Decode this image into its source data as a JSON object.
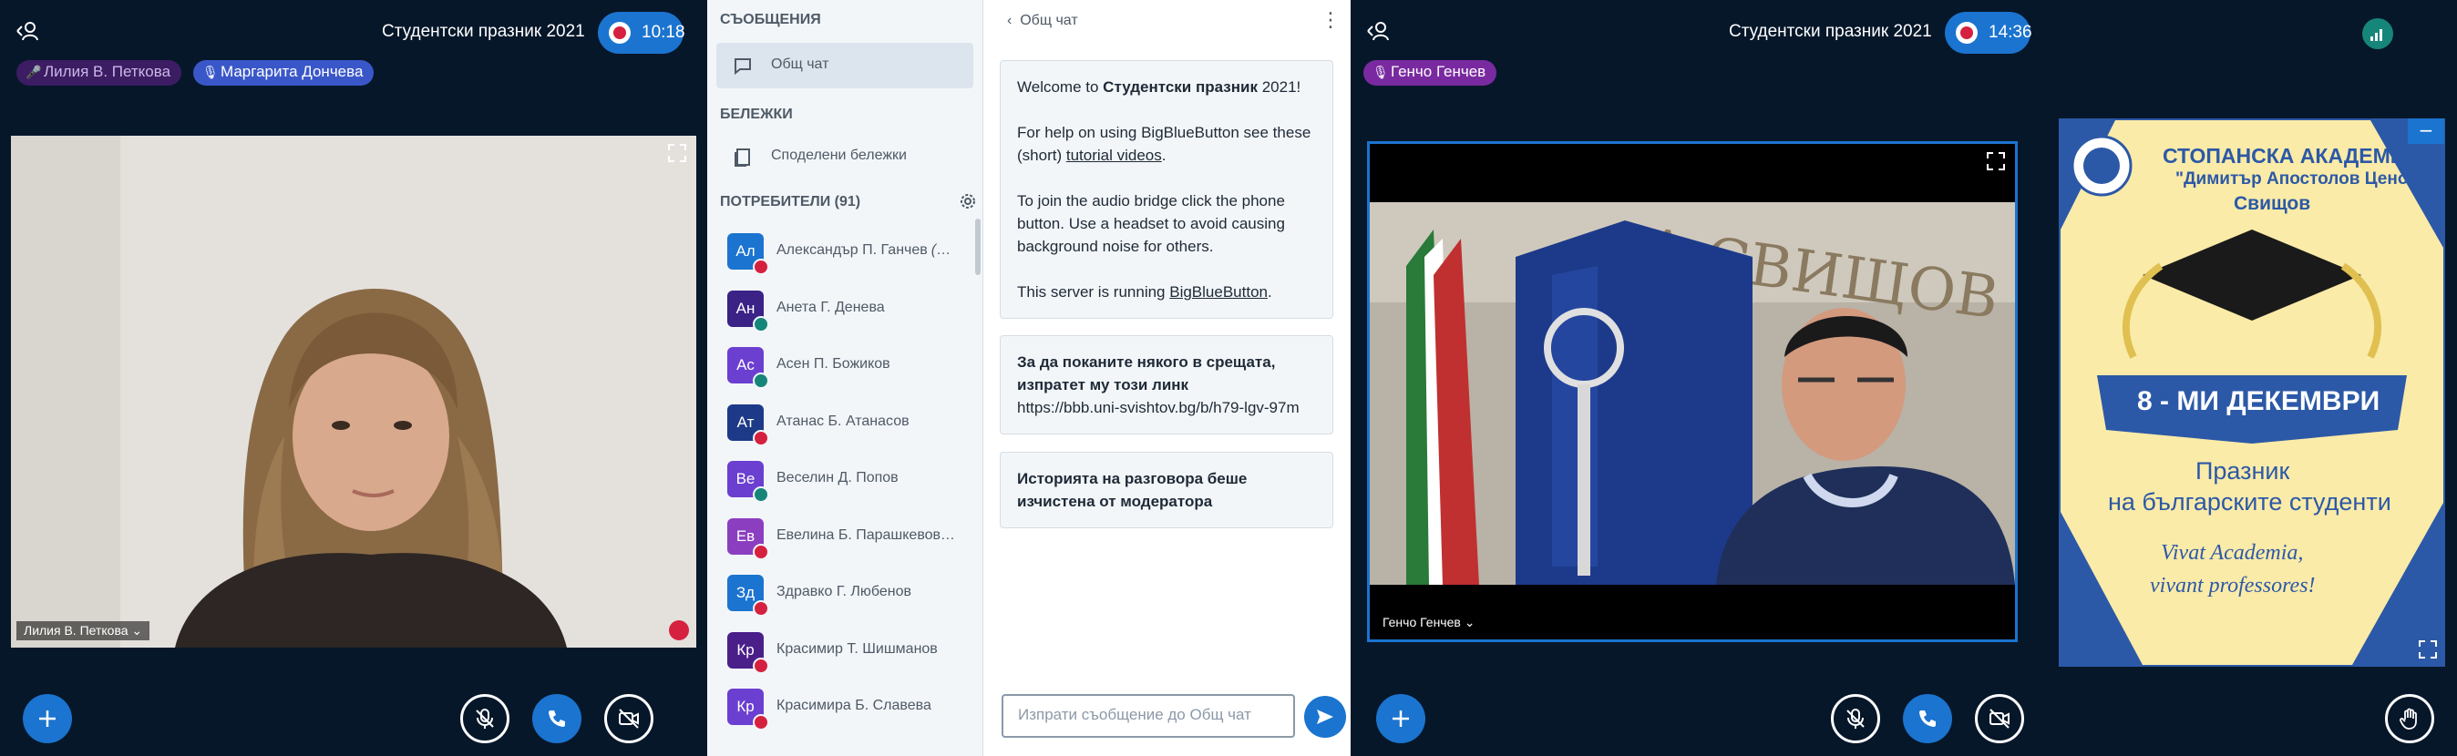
{
  "left_meeting": {
    "title": "Студентски празник 2021",
    "timer": "10:18",
    "talkers": [
      "Лилия В. Петкова",
      "Маргарита Дончева"
    ],
    "video_name": "Лилия В. Петкова"
  },
  "sidebar": {
    "messages_title": "СЪОБЩЕНИЯ",
    "public_chat": "Общ чат",
    "notes_title": "БЕЛЕЖКИ",
    "shared_notes": "Споделени бележки",
    "users_title": "ПОТРЕБИТЕЛИ (91)",
    "users": [
      {
        "initials": "Ал",
        "name": "Александър П. Ганчев",
        "suffix": "(Вие)",
        "color": "#1b74cf",
        "status": "muted"
      },
      {
        "initials": "Ан",
        "name": "Анета Г. Денева",
        "color": "#3a2287",
        "status": "listen"
      },
      {
        "initials": "Ас",
        "name": "Асен П. Божиков",
        "color": "#6b3fd0",
        "status": "listen"
      },
      {
        "initials": "Ат",
        "name": "Атанас Б. Атанасов",
        "color": "#1c3a87",
        "status": "muted"
      },
      {
        "initials": "Ве",
        "name": "Веселин Д. Попов",
        "color": "#6b3fd0",
        "status": "listen"
      },
      {
        "initials": "Ев",
        "name": "Евелина Б. Парашкевова-В...",
        "color": "#8b3fc0",
        "status": "muted"
      },
      {
        "initials": "Зд",
        "name": "Здравко Г. Любенов",
        "color": "#1b74cf",
        "status": "muted"
      },
      {
        "initials": "Кр",
        "name": "Красимир Т. Шишманов",
        "color": "#4a1f8a",
        "status": "muted"
      },
      {
        "initials": "Кр",
        "name": "Красимира Б. Славева",
        "color": "#6b3fd0",
        "status": "muted"
      }
    ]
  },
  "chat": {
    "header": "Общ чат",
    "welcome_prefix": "Welcome to ",
    "welcome_bold": "Студентски празник",
    "welcome_suffix": " 2021!",
    "help_prefix": "For help on using BigBlueButton see these (short) ",
    "help_link": "tutorial videos",
    "help_suffix": ".",
    "audio_text": "To join the audio bridge click the phone button. Use a headset to avoid causing background noise for others.",
    "server_prefix": "This server is running ",
    "server_link": "BigBlueButton",
    "server_suffix": ".",
    "invite_text": "За да поканите някого в срещата, изпратет му този линк",
    "invite_link": "https://bbb.uni-svishtov.bg/b/h79-lgv-97m",
    "cleared_text": "Историята на разговора беше изчистена от модератора",
    "input_placeholder": "Изпрати съобщение до Общ чат"
  },
  "right_meeting": {
    "title": "Студентски празник 2021",
    "timer": "14:36",
    "talker": "Генчо Генчев",
    "video_name": "Генчо Генчев"
  },
  "presentation": {
    "line1": "СТОПАНСКА АКАДЕМИЯ",
    "line2": "\"Димитър Апостолов Ценов\"",
    "line3": "Свищов",
    "date": "8 - МИ ДЕКЕМВРИ",
    "holiday1": "Празник",
    "holiday2": "на българските студенти",
    "motto1": "Vivat Academia,",
    "motto2": "vivant professores!"
  },
  "colors": {
    "accent": "#1b74cf",
    "background": "#06172a",
    "muted": "#d5213f",
    "listen": "#16857a"
  }
}
